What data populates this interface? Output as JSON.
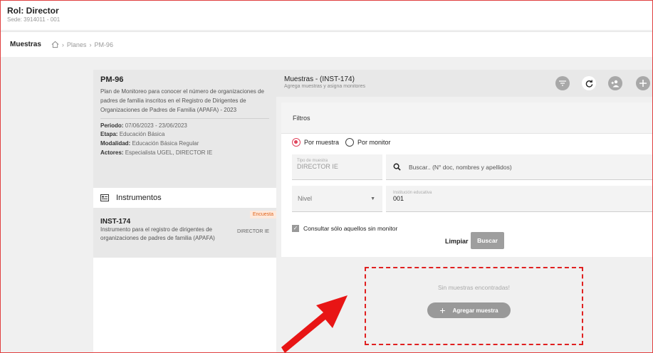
{
  "header": {
    "role": "Rol: Director",
    "sede": "Sede: 3914011 - 001"
  },
  "breadcrumb": {
    "section": "Muestras",
    "items": [
      "Planes",
      "PM-96"
    ]
  },
  "plan": {
    "code": "PM-96",
    "description": "Plan de Monitoreo para conocer el número de organizaciones de padres de familia inscritos en el Registro de Dirigentes de Organizaciones de Padres de Familia (APAFA) - 2023",
    "periodo_label": "Periodo:",
    "periodo": "07/06/2023 - 23/06/2023",
    "etapa_label": "Etapa:",
    "etapa": "Educación Básica",
    "modalidad_label": "Modalidad:",
    "modalidad": "Educación Básica Regular",
    "actores_label": "Actores:",
    "actores": "Especialista UGEL, DIRECTOR IE"
  },
  "instrumentos": {
    "heading": "Instrumentos",
    "item": {
      "tag": "Encuesta",
      "code": "INST-174",
      "description": "Instrumento para el registro de dirigentes de organizaciones de padres de familia (APAFA)",
      "role": "DIRECTOR IE"
    }
  },
  "muestras": {
    "title": "Muestras - (INST-174)",
    "subtitle": "Agrega muestras y asigna monitores",
    "actions": [
      "filter-icon",
      "refresh-icon",
      "assign-monitor-icon",
      "add-icon"
    ]
  },
  "filters": {
    "title": "Filtros",
    "radio_muestra": "Por muestra",
    "radio_monitor": "Por monitor",
    "tipo_label": "Tipo de muestra",
    "tipo_value": "DIRECTOR IE",
    "search_placeholder": "Buscar.. (N° doc, nombres y apellidos)",
    "nivel_label": "Nivel",
    "institucion_label": "Institución educativa",
    "institucion_value": "001",
    "checkbox_label": "Consultar sólo aquellos sin monitor",
    "clear_label": "Limpiar",
    "search_label": "Buscar"
  },
  "empty": {
    "message": "Sin muestras encontradas!",
    "add_label": "Agregar muestra"
  },
  "colors": {
    "accent": "#e0445c",
    "annotation": "#e02020"
  }
}
